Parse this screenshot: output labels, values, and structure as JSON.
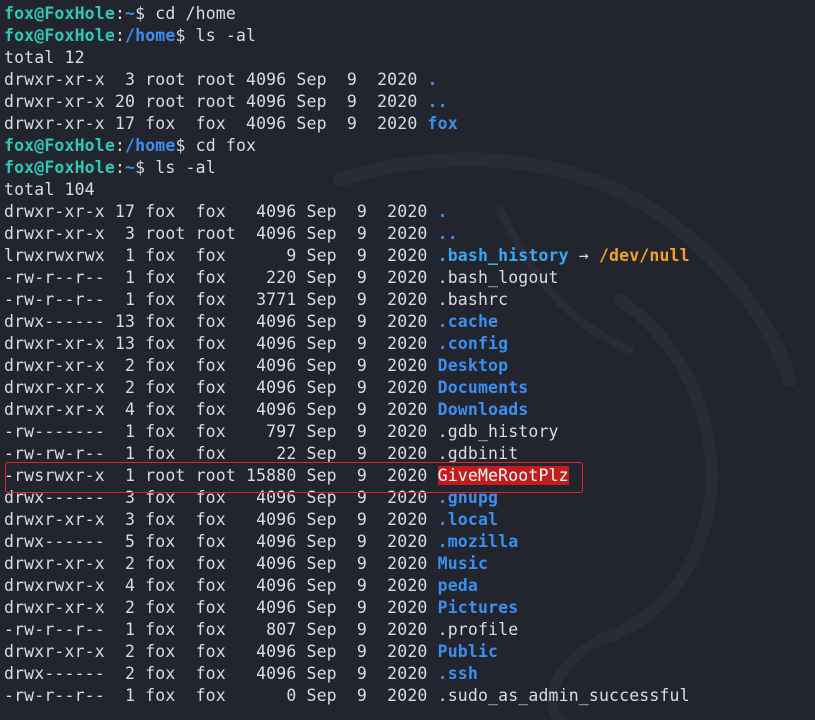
{
  "prompt": {
    "user": "fox@FoxHole",
    "sep": ":",
    "dollar": "$ "
  },
  "colors": {
    "background": "#23252e",
    "prompt_user": "#2dc8b6",
    "dir": "#3c8ff0",
    "symlink_target": "#f0a227",
    "suid_bg": "#c31c1c",
    "highlight_border": "#e02424"
  },
  "commands": [
    {
      "path": "~",
      "cmd": "cd /home"
    },
    {
      "path": "/home",
      "cmd": "ls -al"
    },
    {
      "path": "/home",
      "cmd": "cd fox"
    },
    {
      "path": "~",
      "cmd": "ls -al"
    }
  ],
  "home_listing": {
    "total": "total 12",
    "rows": [
      {
        "meta": "drwxr-xr-x  3 root root 4096 Sep  9  2020 ",
        "name": "."
      },
      {
        "meta": "drwxr-xr-x 20 root root 4096 Sep  9  2020 ",
        "name": ".."
      },
      {
        "meta": "drwxr-xr-x 17 fox  fox  4096 Sep  9  2020 ",
        "name": "fox"
      }
    ]
  },
  "fox_listing": {
    "total": "total 104",
    "arrow": " → ",
    "rows": [
      {
        "meta": "drwxr-xr-x 17 fox  fox   4096 Sep  9  2020 ",
        "name": "."
      },
      {
        "meta": "drwxr-xr-x  3 root root  4096 Sep  9  2020 ",
        "name": ".."
      },
      {
        "meta": "lrwxrwxrwx  1 fox  fox      9 Sep  9  2020 ",
        "name": ".bash_history",
        "target": "/dev/null"
      },
      {
        "meta": "-rw-r--r--  1 fox  fox    220 Sep  9  2020 ",
        "name": ".bash_logout"
      },
      {
        "meta": "-rw-r--r--  1 fox  fox   3771 Sep  9  2020 ",
        "name": ".bashrc"
      },
      {
        "meta": "drwx------ 13 fox  fox   4096 Sep  9  2020 ",
        "name": ".cache"
      },
      {
        "meta": "drwxr-xr-x 13 fox  fox   4096 Sep  9  2020 ",
        "name": ".config"
      },
      {
        "meta": "drwxr-xr-x  2 fox  fox   4096 Sep  9  2020 ",
        "name": "Desktop"
      },
      {
        "meta": "drwxr-xr-x  2 fox  fox   4096 Sep  9  2020 ",
        "name": "Documents"
      },
      {
        "meta": "drwxr-xr-x  4 fox  fox   4096 Sep  9  2020 ",
        "name": "Downloads"
      },
      {
        "meta": "-rw-------  1 fox  fox    797 Sep  9  2020 ",
        "name": ".gdb_history"
      },
      {
        "meta": "-rw-rw-r--  1 fox  fox     22 Sep  9  2020 ",
        "name": ".gdbinit"
      },
      {
        "meta": "-rwsrwxr-x  1 root root 15880 Sep  9  2020 ",
        "name": "GiveMeRootPlz"
      },
      {
        "meta": "drwx------  3 fox  fox   4096 Sep  9  2020 ",
        "name": ".gnupg"
      },
      {
        "meta": "drwxr-xr-x  3 fox  fox   4096 Sep  9  2020 ",
        "name": ".local"
      },
      {
        "meta": "drwx------  5 fox  fox   4096 Sep  9  2020 ",
        "name": ".mozilla"
      },
      {
        "meta": "drwxr-xr-x  2 fox  fox   4096 Sep  9  2020 ",
        "name": "Music"
      },
      {
        "meta": "drwxrwxr-x  4 fox  fox   4096 Sep  9  2020 ",
        "name": "peda"
      },
      {
        "meta": "drwxr-xr-x  2 fox  fox   4096 Sep  9  2020 ",
        "name": "Pictures"
      },
      {
        "meta": "-rw-r--r--  1 fox  fox    807 Sep  9  2020 ",
        "name": ".profile"
      },
      {
        "meta": "drwxr-xr-x  2 fox  fox   4096 Sep  9  2020 ",
        "name": "Public"
      },
      {
        "meta": "drwx------  2 fox  fox   4096 Sep  9  2020 ",
        "name": ".ssh"
      },
      {
        "meta": "-rw-r--r--  1 fox  fox      0 Sep  9  2020 ",
        "name": ".sudo_as_admin_successful"
      }
    ]
  }
}
